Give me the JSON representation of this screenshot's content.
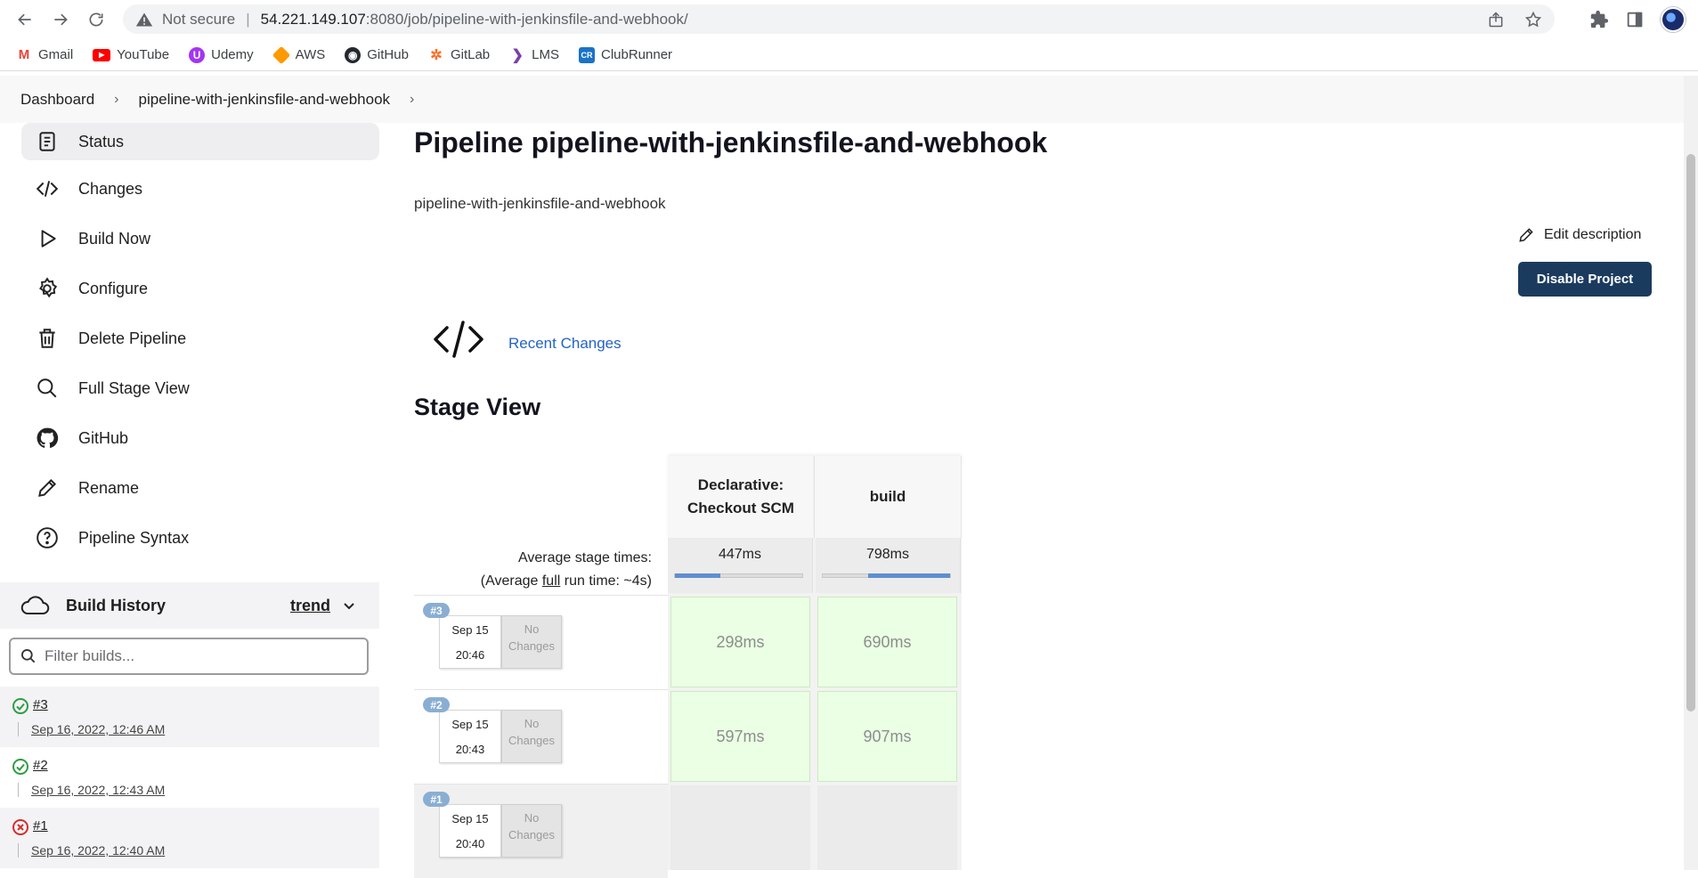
{
  "browser": {
    "not_secure": "Not secure",
    "url_host": "54.221.149.107",
    "url_path": ":8080/job/pipeline-with-jenkinsfile-and-webhook/"
  },
  "bookmarks": [
    {
      "label": "Gmail",
      "icon": "gmail-icon",
      "color": "#ea4335"
    },
    {
      "label": "YouTube",
      "icon": "youtube-icon",
      "color": "#ff0000"
    },
    {
      "label": "Udemy",
      "icon": "udemy-icon",
      "color": "#a435f0"
    },
    {
      "label": "AWS",
      "icon": "aws-icon",
      "color": "#ff9900"
    },
    {
      "label": "GitHub",
      "icon": "github-icon",
      "color": "#24292f"
    },
    {
      "label": "GitLab",
      "icon": "gitlab-icon",
      "color": "#fc6d26"
    },
    {
      "label": "LMS",
      "icon": "lms-icon",
      "color": "#7b3fa8"
    },
    {
      "label": "ClubRunner",
      "icon": "clubrunner-icon",
      "color": "#1a73c7"
    }
  ],
  "breadcrumb": {
    "home": "Dashboard",
    "job": "pipeline-with-jenkinsfile-and-webhook"
  },
  "sidebar": {
    "items": [
      {
        "label": "Status",
        "icon": "status-icon"
      },
      {
        "label": "Changes",
        "icon": "code-icon"
      },
      {
        "label": "Build Now",
        "icon": "play-icon"
      },
      {
        "label": "Configure",
        "icon": "gear-icon"
      },
      {
        "label": "Delete Pipeline",
        "icon": "trash-icon"
      },
      {
        "label": "Full Stage View",
        "icon": "search-icon"
      },
      {
        "label": "GitHub",
        "icon": "github-icon"
      },
      {
        "label": "Rename",
        "icon": "pencil-icon"
      },
      {
        "label": "Pipeline Syntax",
        "icon": "help-icon"
      }
    ]
  },
  "build_history": {
    "title": "Build History",
    "trend": "trend",
    "filter_placeholder": "Filter builds...",
    "builds": [
      {
        "number": "#3",
        "date": "Sep 16, 2022, 12:46 AM",
        "status": "success"
      },
      {
        "number": "#2",
        "date": "Sep 16, 2022, 12:43 AM",
        "status": "success"
      },
      {
        "number": "#1",
        "date": "Sep 16, 2022, 12:40 AM",
        "status": "failed"
      }
    ]
  },
  "main": {
    "title": "Pipeline pipeline-with-jenkinsfile-and-webhook",
    "description": "pipeline-with-jenkinsfile-and-webhook",
    "edit_description": "Edit description",
    "disable_button": "Disable Project",
    "recent_changes": "Recent Changes",
    "stage_view_title": "Stage View"
  },
  "stage_view": {
    "avg_label_line1": "Average stage times:",
    "avg_label_prefix": "(Average ",
    "avg_label_full": "full",
    "avg_label_suffix": " run time: ~4s)",
    "stages": [
      {
        "name_line1": "Declarative:",
        "name_line2": "Checkout SCM",
        "avg": "447ms",
        "avg_fill_start": 0,
        "avg_fill_fraction": 0.36
      },
      {
        "name_line1": "build",
        "name_line2": "",
        "avg": "798ms",
        "avg_fill_start": 0.36,
        "avg_fill_fraction": 0.64
      }
    ],
    "runs": [
      {
        "badge": "#3",
        "date": "Sep 15",
        "time": "20:46",
        "changes_line1": "No",
        "changes_line2": "Changes",
        "cells": [
          "298ms",
          "690ms"
        ]
      },
      {
        "badge": "#2",
        "date": "Sep 15",
        "time": "20:43",
        "changes_line1": "No",
        "changes_line2": "Changes",
        "cells": [
          "597ms",
          "907ms"
        ]
      },
      {
        "badge": "#1",
        "date": "Sep 15",
        "time": "20:40",
        "changes_line1": "No",
        "changes_line2": "Changes",
        "cells": [
          "",
          ""
        ]
      }
    ]
  }
}
